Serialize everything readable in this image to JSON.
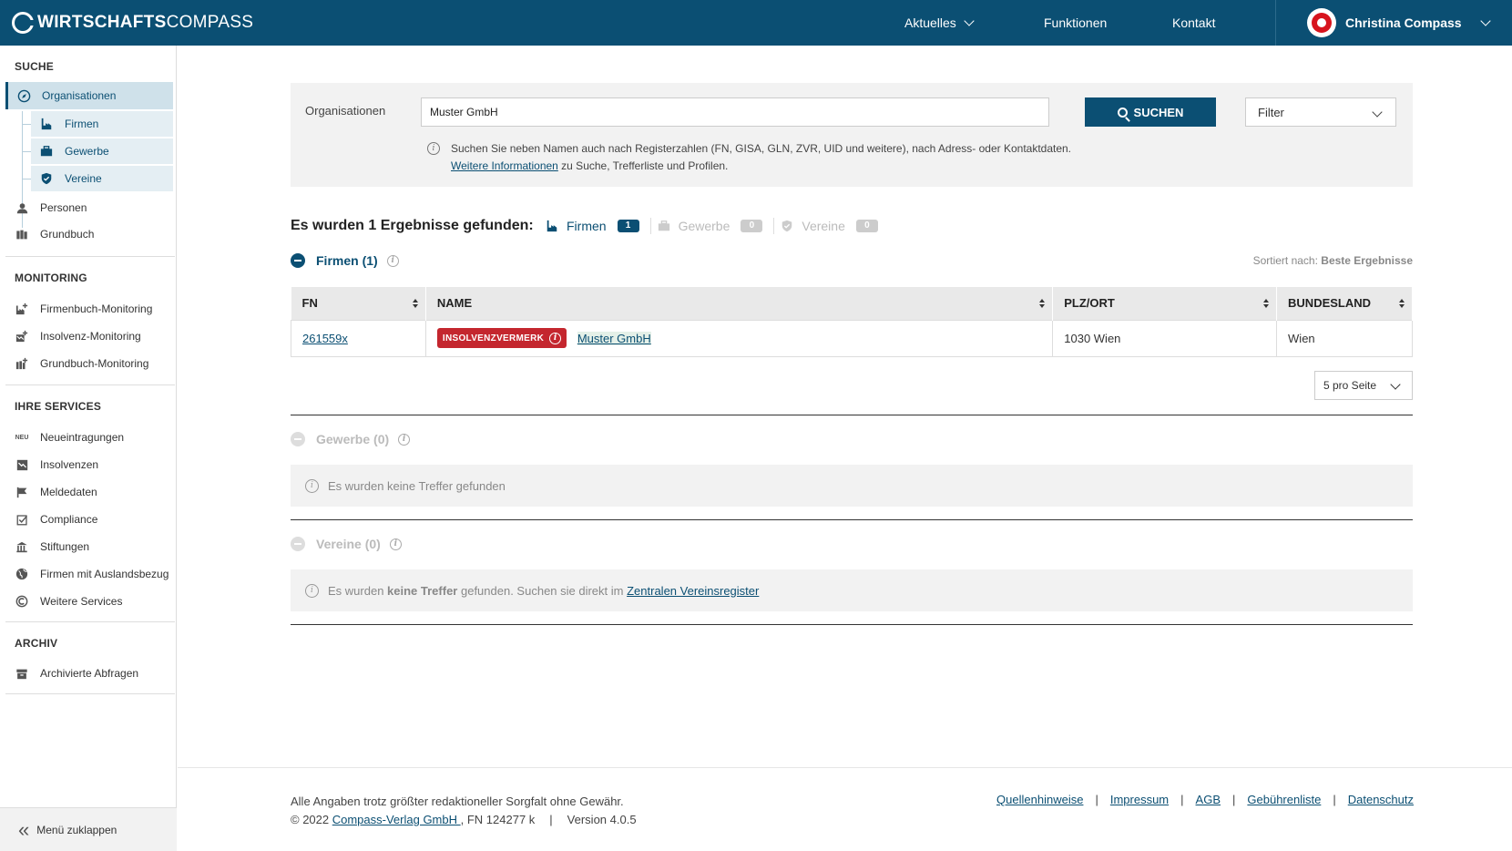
{
  "header": {
    "logo_bold": "WIRTSCHAFTS",
    "logo_light": "COMPASS",
    "nav": [
      "Aktuelles",
      "Funktionen",
      "Kontakt"
    ],
    "user": "Christina Compass"
  },
  "sidebar": {
    "section_search": "SUCHE",
    "organisationen": "Organisationen",
    "sub": [
      "Firmen",
      "Gewerbe",
      "Vereine"
    ],
    "personen": "Personen",
    "grundbuch": "Grundbuch",
    "section_monitoring": "MONITORING",
    "monitoring": [
      "Firmenbuch-Monitoring",
      "Insolvenz-Monitoring",
      "Grundbuch-Monitoring"
    ],
    "section_services": "IHRE SERVICES",
    "neu_tag": "NEU",
    "services": [
      "Neueintragungen",
      "Insolvenzen",
      "Meldedaten",
      "Compliance",
      "Stiftungen",
      "Firmen mit Auslandsbezug",
      "Weitere Services"
    ],
    "section_archiv": "ARCHIV",
    "archiv": [
      "Archivierte Abfragen"
    ],
    "collapse": "Menü zuklappen"
  },
  "search": {
    "label": "Organisationen",
    "value": "Muster GmbH",
    "button": "SUCHEN",
    "filter": "Filter",
    "hint_line1": "Suchen Sie neben Namen auch nach Registerzahlen (FN, GISA, GLN, ZVR, UID und weitere), nach Adress- oder Kontaktdaten.",
    "hint_link": "Weitere Informationen",
    "hint_line2": " zu Suche, Trefferliste und Profilen."
  },
  "results": {
    "title": "Es wurden 1 Ergebnisse gefunden:",
    "tabs": [
      {
        "label": "Firmen",
        "count": "1"
      },
      {
        "label": "Gewerbe",
        "count": "0"
      },
      {
        "label": "Vereine",
        "count": "0"
      }
    ],
    "firmen_head": "Firmen (1)",
    "sort_label": "Sortiert nach:",
    "sort_value": "Beste Ergebnisse",
    "columns": [
      "FN",
      "NAME",
      "PLZ/ORT",
      "BUNDESLAND"
    ],
    "row": {
      "fn": "261559x",
      "badge": "INSOLVENZVERMERK",
      "name": "Muster GmbH",
      "plz_ort": "1030 Wien",
      "bundesland": "Wien"
    },
    "per_page": "5 pro Seite",
    "gewerbe_head": "Gewerbe (0)",
    "gewerbe_empty": "Es wurden keine Treffer gefunden",
    "vereine_head": "Vereine (0)",
    "vereine_empty_a": "Es wurden ",
    "vereine_empty_b": "keine Treffer",
    "vereine_empty_c": " gefunden. Suchen sie direkt im ",
    "vereine_link": "Zentralen Vereinsregister"
  },
  "footer": {
    "line1": "Alle Angaben trotz größter redaktioneller Sorgfalt ohne Gewähr.",
    "copyright": "© 2022 ",
    "company_link": "Compass-Verlag GmbH ",
    "fn": ", FN 124277 k",
    "version": "Version 4.0.5",
    "links": [
      "Quellenhinweise",
      "Impressum",
      "AGB",
      "Gebührenliste",
      "Datenschutz"
    ]
  },
  "colors": {
    "primary": "#0b4f73",
    "danger": "#c4262e",
    "brand_red": "#d7141d"
  }
}
